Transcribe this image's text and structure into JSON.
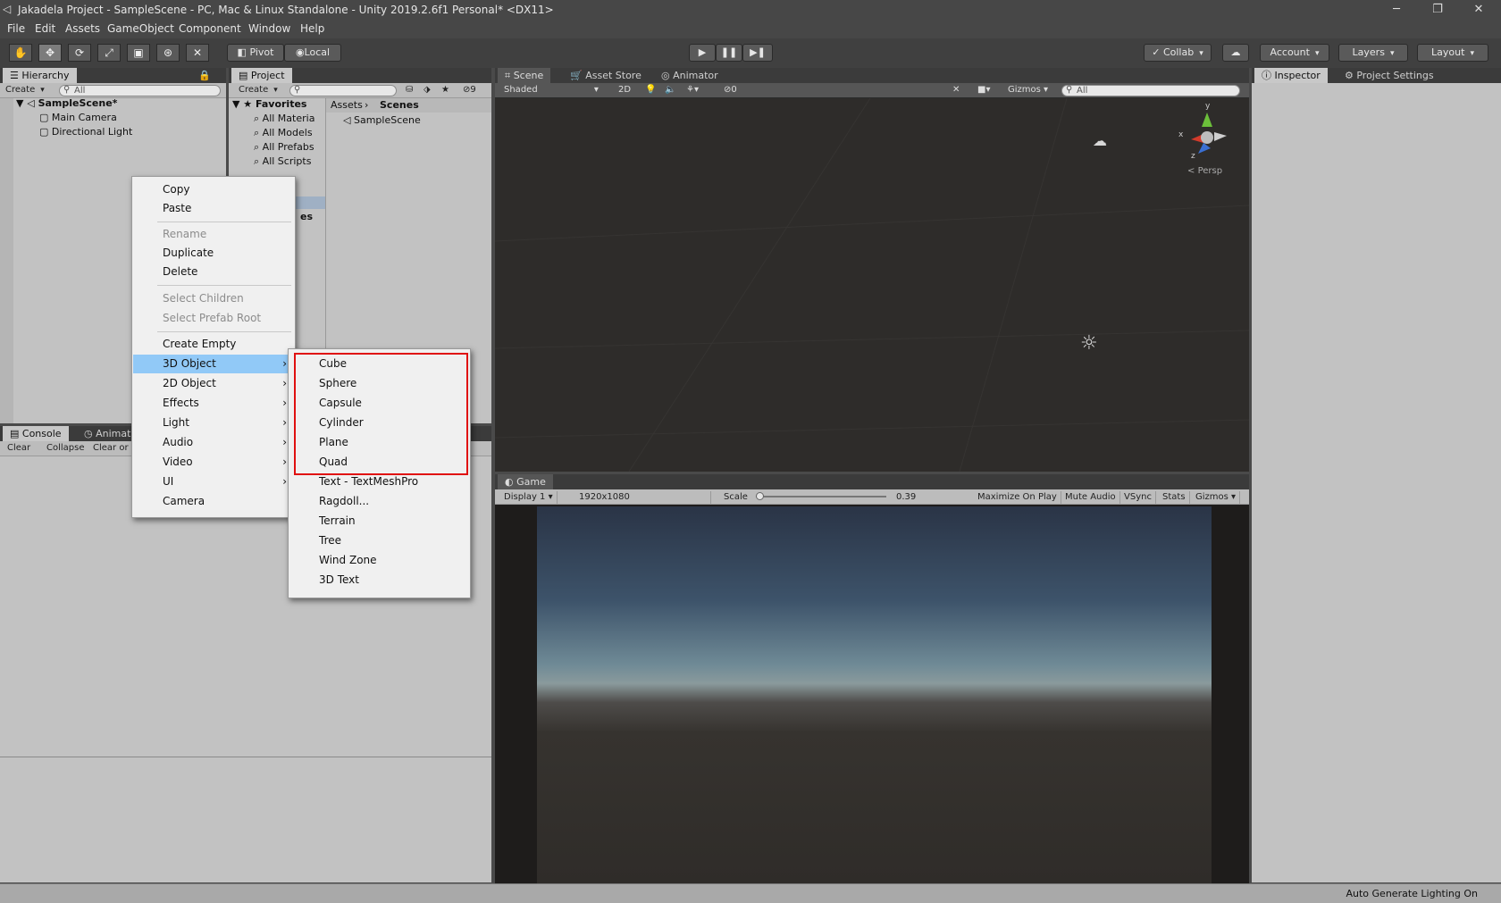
{
  "window": {
    "title": "Jakadela Project - SampleScene - PC, Mac & Linux Standalone - Unity 2019.2.6f1 Personal* <DX11>",
    "minimize": "─",
    "restore": "❐",
    "close": "✕"
  },
  "menubar": [
    "File",
    "Edit",
    "Assets",
    "GameObject",
    "Component",
    "Window",
    "Help"
  ],
  "toolbar": {
    "pivot": "Pivot",
    "local": "Local",
    "collab": "Collab",
    "account": "Account",
    "layers": "Layers",
    "layout": "Layout",
    "tools": [
      "hand-tool-icon",
      "move-tool-icon",
      "rotate-tool-icon",
      "scale-tool-icon",
      "rect-tool-icon",
      "transform-tool-icon",
      "custom-tool-icon"
    ]
  },
  "hierarchy": {
    "tab": "Hierarchy",
    "create": "Create",
    "search_placeholder": "All",
    "scene": "SampleScene*",
    "items": [
      "Main Camera",
      "Directional Light"
    ]
  },
  "project": {
    "tab": "Project",
    "create": "Create",
    "hidden_count": "9",
    "favorites_label": "Favorites",
    "favorites": [
      "All Materia",
      "All Models",
      "All Prefabs",
      "All Scripts"
    ],
    "breadcrumb": [
      "Assets",
      "Scenes"
    ],
    "assets": [
      "SampleScene"
    ],
    "partial_row": "es"
  },
  "console": {
    "tab": "Console",
    "animation_tab": "Animat",
    "buttons": [
      "Clear",
      "Collapse",
      "Clear or"
    ]
  },
  "scene": {
    "tabs": [
      "Scene",
      "Asset Store",
      "Animator"
    ],
    "shading": "Shaded",
    "mode_2d": "2D",
    "fx_count": "0",
    "gizmos": "Gizmos",
    "search_placeholder": "All",
    "persp": "Persp",
    "axis_y": "y",
    "axis_x": "x",
    "axis_z": "z"
  },
  "game": {
    "tab": "Game",
    "display": "Display 1",
    "resolution": "1920x1080",
    "scale_label": "Scale",
    "scale_value": "0.39",
    "scale_fraction": 0.0,
    "maximize": "Maximize On Play",
    "mute": "Mute Audio",
    "vsync": "VSync",
    "stats": "Stats",
    "gizmos": "Gizmos"
  },
  "inspector": {
    "tab": "Inspector",
    "settings_tab": "Project Settings"
  },
  "statusbar": {
    "text": "Auto Generate Lighting On"
  },
  "context_menu": {
    "items": [
      {
        "label": "Copy",
        "enabled": true
      },
      {
        "label": "Paste",
        "enabled": true
      },
      {
        "label": "Rename",
        "enabled": false
      },
      {
        "label": "Duplicate",
        "enabled": true
      },
      {
        "label": "Delete",
        "enabled": true
      },
      {
        "label": "Select Children",
        "enabled": false
      },
      {
        "label": "Select Prefab Root",
        "enabled": false
      },
      {
        "label": "Create Empty",
        "enabled": true
      },
      {
        "label": "3D Object",
        "enabled": true,
        "submenu": true,
        "highlighted": true
      },
      {
        "label": "2D Object",
        "enabled": true,
        "submenu": true
      },
      {
        "label": "Effects",
        "enabled": true,
        "submenu": true
      },
      {
        "label": "Light",
        "enabled": true,
        "submenu": true
      },
      {
        "label": "Audio",
        "enabled": true,
        "submenu": true
      },
      {
        "label": "Video",
        "enabled": true,
        "submenu": true
      },
      {
        "label": "UI",
        "enabled": true,
        "submenu": true
      },
      {
        "label": "Camera",
        "enabled": true
      }
    ],
    "arrow": "›"
  },
  "submenu_3d": {
    "items": [
      "Cube",
      "Sphere",
      "Capsule",
      "Cylinder",
      "Plane",
      "Quad",
      "Text - TextMeshPro",
      "Ragdoll...",
      "Terrain",
      "Tree",
      "Wind Zone",
      "3D Text"
    ],
    "highlight_color": "#e01010"
  },
  "colors": {
    "menu_highlight": "#91c9f7",
    "panel_light": "#c2c2c2",
    "scene_bg": "#2e2c2a",
    "annotation": "#e01010"
  }
}
